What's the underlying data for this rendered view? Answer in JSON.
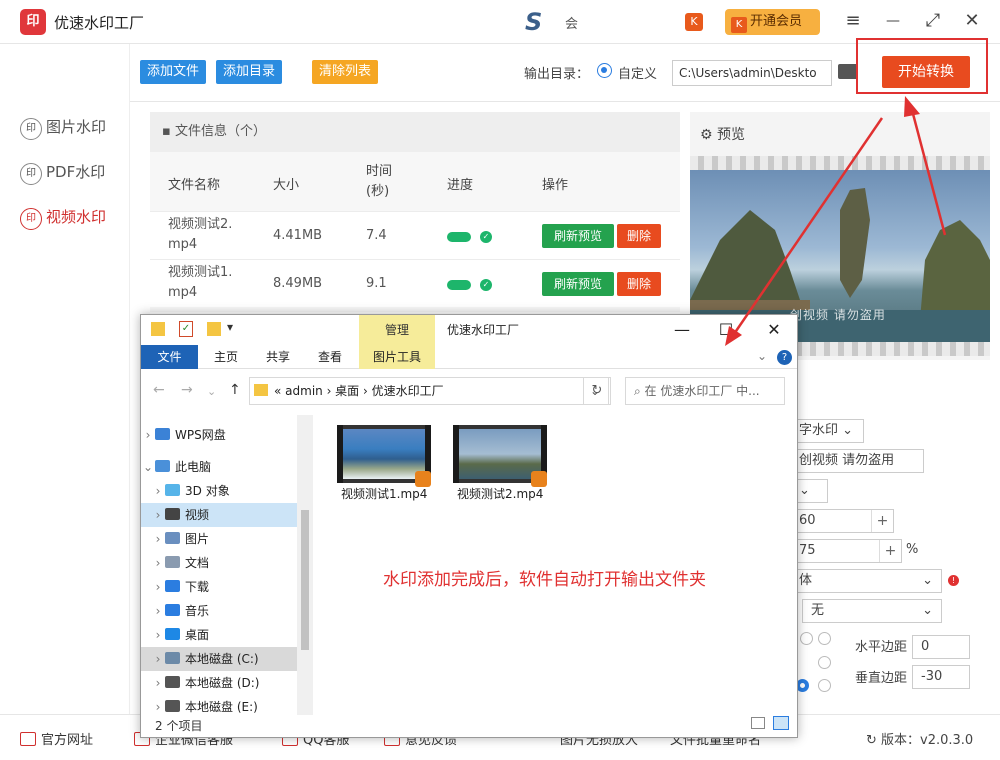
{
  "app": {
    "title": "优速水印工厂",
    "logo_char": "印",
    "hui": "会",
    "vip_label": "开通会员",
    "vip_k": "K"
  },
  "window_controls": {
    "menu": "≡",
    "minimize": "—",
    "maximize": "⤢",
    "close": "✕"
  },
  "nav": [
    {
      "label": "图片水印",
      "icon": "印"
    },
    {
      "label": "PDF水印",
      "icon": "印"
    },
    {
      "label": "视频水印",
      "icon": "印",
      "active": true
    }
  ],
  "toolbar": {
    "add_file": "添加文件",
    "add_dir": "添加目录",
    "clear_list": "清除列表",
    "output_label": "输出目录：",
    "radio_custom": "自定义",
    "path_value": "C:\\Users\\admin\\Deskto",
    "start": "开始转换"
  },
  "file_panel": {
    "header": "文件信息（个）",
    "columns": [
      "文件名称",
      "大小",
      "时间\n(秒)",
      "进度",
      "操作"
    ],
    "col_time_l1": "时间",
    "col_time_l2": "(秒)",
    "rows": [
      {
        "name_l1": "视频测试2.",
        "name_l2": "mp4",
        "size": "4.41MB",
        "time": "7.4",
        "progress": 1.0,
        "refresh": "刷新预览",
        "delete": "删除"
      },
      {
        "name_l1": "视频测试1.",
        "name_l2": "mp4",
        "size": "8.49MB",
        "time": "9.1",
        "progress": 1.0,
        "refresh": "刷新预览",
        "delete": "删除"
      }
    ]
  },
  "preview": {
    "header": "预览",
    "watermark": "创视频 请勿盗用"
  },
  "settings": {
    "watermark_type": "字水印",
    "watermark_text": "创视频 请勿盗用",
    "val1": "60",
    "val2": "75",
    "percent": "%",
    "font": "体",
    "none_option": "无",
    "h_margin_label": "水平边距",
    "h_margin": "0",
    "v_margin_label": "垂直边距",
    "v_margin": "-30",
    "plus": "+"
  },
  "bottom": {
    "website": "官方网址",
    "wechat": "企业微信客服",
    "qq": "QQ客服",
    "feedback": "意见反馈",
    "img_enlarge": "图片无损放大",
    "batch_rename": "文件批量重命名",
    "version": "版本：v2.0.3.0"
  },
  "explorer": {
    "manage": "管理",
    "title": "优速水印工厂",
    "tabs": [
      "文件",
      "主页",
      "共享",
      "查看",
      "图片工具"
    ],
    "path": [
      "«",
      "admin",
      "›",
      "桌面",
      "›",
      "优速水印工厂"
    ],
    "path_text": "«  admin  ›  桌面  ›  优速水印工厂",
    "search_placeholder": "在 优速水印工厂 中...",
    "tree": [
      {
        "label": "WPS网盘",
        "color": "#3b82d6"
      },
      {
        "label": "此电脑",
        "color": "#4a90d9"
      },
      {
        "label": "3D 对象",
        "color": "#56b4e9"
      },
      {
        "label": "视频",
        "color": "#444444"
      },
      {
        "label": "图片",
        "color": "#6a8fbf"
      },
      {
        "label": "文档",
        "color": "#8a9bb0"
      },
      {
        "label": "下载",
        "color": "#2b7de0"
      },
      {
        "label": "音乐",
        "color": "#2b7de0"
      },
      {
        "label": "桌面",
        "color": "#1e88e5"
      },
      {
        "label": "本地磁盘 (C:)",
        "color": "#6c8aa8"
      },
      {
        "label": "本地磁盘 (D:)",
        "color": "#555555"
      },
      {
        "label": "本地磁盘 (E:)",
        "color": "#555555"
      }
    ],
    "files": [
      "视频测试1.mp4",
      "视频测试2.mp4"
    ],
    "status": "2 个项目",
    "overlay": "水印添加完成后，软件自动打开输出文件夹"
  },
  "colors": {
    "accent_red": "#e84b1f",
    "blue": "#2b7de0",
    "green": "#24a24e",
    "orange": "#f5a623"
  }
}
